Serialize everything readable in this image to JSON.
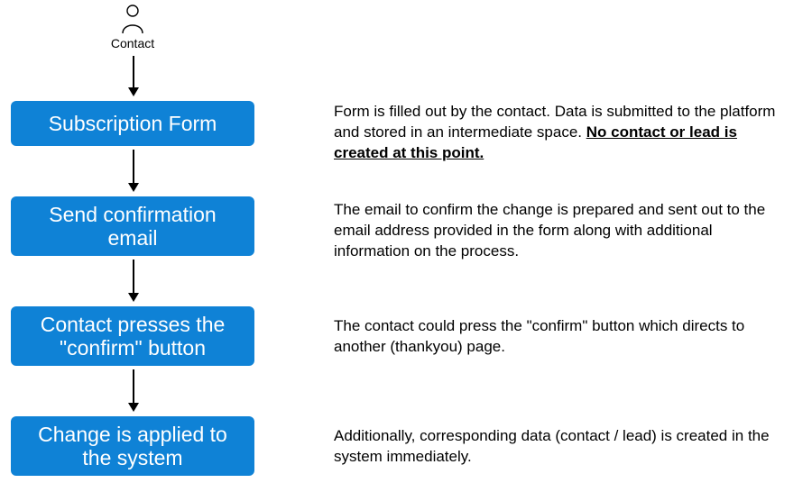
{
  "actor": {
    "label": "Contact"
  },
  "steps": [
    {
      "title": "Subscription Form"
    },
    {
      "title": "Send confirmation email"
    },
    {
      "title": "Contact presses the \"confirm\" button"
    },
    {
      "title": "Change is applied to the system"
    }
  ],
  "descriptions": {
    "d1_plain": "Form is filled out by the contact. Data is submitted to the platform and stored in an intermediate space. ",
    "d1_emph": "No contact or lead is created at this point.",
    "d2": "The email to confirm the change is prepared and sent out to the email address provided in the form along with additional information on the process.",
    "d3": "The contact could press the \"confirm\" button which directs to another (thankyou) page.",
    "d4": "Additionally, corresponding data (contact / lead) is created in the system immediately."
  },
  "colors": {
    "box_bg": "#0f82d6",
    "box_fg": "#ffffff"
  }
}
